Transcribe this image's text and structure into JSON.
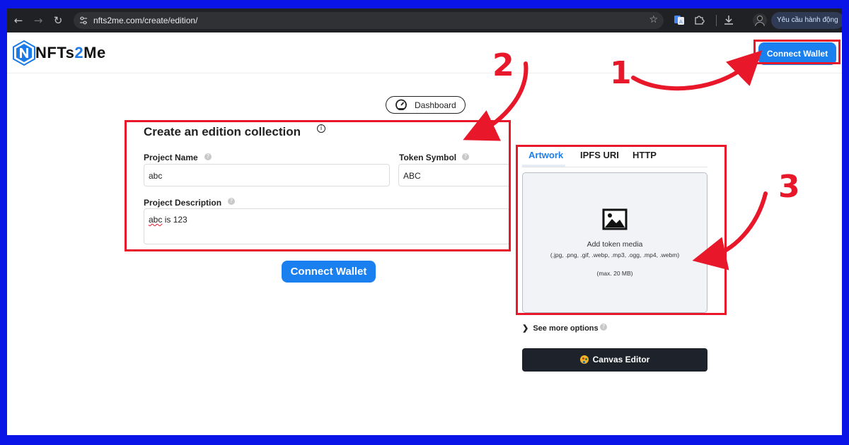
{
  "browser": {
    "url": "nfts2me.com/create/edition/",
    "action_chip": "Yêu cầu hành động"
  },
  "site": {
    "logo_prefix": "NFTs",
    "logo_two": "2",
    "logo_suffix": "Me",
    "header_connect": "Connect Wallet"
  },
  "dashboard": {
    "label": "Dashboard"
  },
  "form": {
    "title": "Create an edition collection",
    "project_name_label": "Project Name",
    "project_name_value": "abc",
    "token_symbol_label": "Token Symbol",
    "token_symbol_value": "ABC",
    "description_label": "Project Description",
    "description_word1": "abc",
    "description_rest": " is 123",
    "connect_label": "Connect Wallet"
  },
  "media": {
    "tabs": [
      "Artwork",
      "IPFS URI",
      "HTTP"
    ],
    "active_tab": "Artwork",
    "title": "Add token media",
    "types": "(.jpg, .png, .gif, .webp, .mp3, .ogg, .mp4, .webm)",
    "max": "(max. 20 MB)",
    "see_more": "See more options",
    "canvas_editor": "Canvas Editor"
  },
  "annotations": {
    "step1": "1",
    "step2": "2",
    "step3": "3",
    "color": "#e8182a"
  },
  "colors": {
    "primary": "#1a7fef",
    "border_outer": "#0a14e6"
  }
}
